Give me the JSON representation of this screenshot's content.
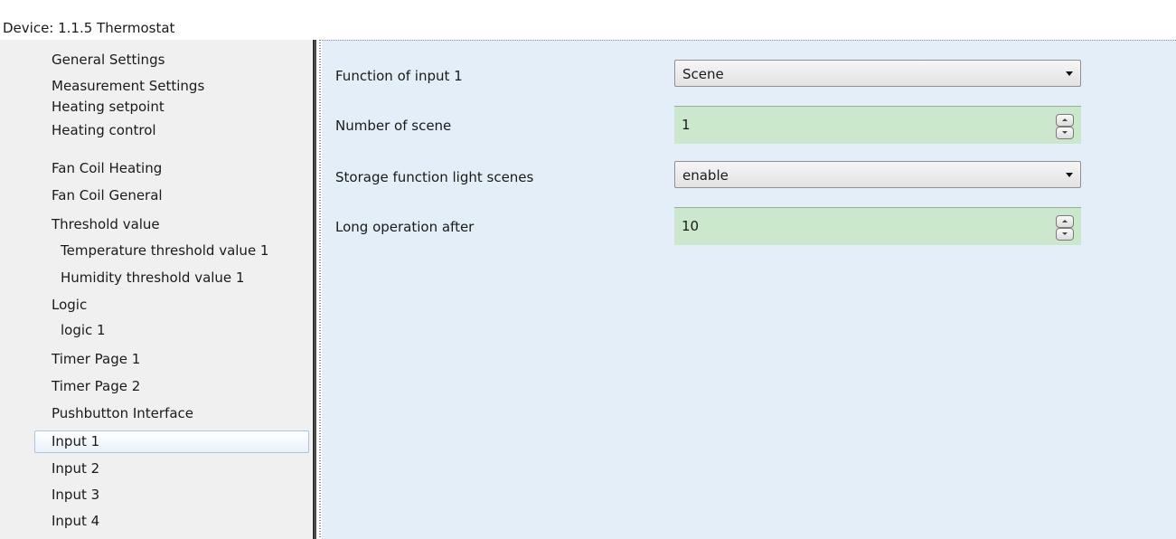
{
  "window": {
    "title": "Device: 1.1.5  Thermostat"
  },
  "sidebar": {
    "items": [
      {
        "label": "General Settings"
      },
      {
        "label": "Measurement Settings"
      },
      {
        "label": "Heating setpoint"
      },
      {
        "label": "Heating control"
      },
      {
        "label": "Fan Coil Heating"
      },
      {
        "label": "Fan Coil General"
      },
      {
        "label": "Threshold value"
      },
      {
        "label": "Temperature threshold value 1"
      },
      {
        "label": "Humidity threshold value 1"
      },
      {
        "label": "Logic"
      },
      {
        "label": "logic 1"
      },
      {
        "label": "Timer Page 1"
      },
      {
        "label": "Timer Page 2"
      },
      {
        "label": "Pushbutton Interface"
      },
      {
        "label": "Input 1"
      },
      {
        "label": "Input 2"
      },
      {
        "label": "Input 3"
      },
      {
        "label": "Input 4"
      }
    ],
    "selected": "Input 1"
  },
  "params": [
    {
      "label": "Function of input 1",
      "control": "dropdown",
      "value": "Scene"
    },
    {
      "label": "Number of scene",
      "control": "spinbox",
      "value": "1"
    },
    {
      "label": "Storage function light scenes",
      "control": "dropdown",
      "value": "enable"
    },
    {
      "label": "Long operation after",
      "control": "spinbox",
      "value": "10"
    }
  ],
  "colors": {
    "content_background": "#e4eef8",
    "sidebar_background": "#f0f0f0",
    "spinbox_background": "#cce8cc",
    "selection_border": "#a9c4e4"
  },
  "icons": {
    "dropdown": "chevron-down-icon",
    "spin_up": "arrow-up-icon",
    "spin_down": "arrow-down-icon"
  }
}
